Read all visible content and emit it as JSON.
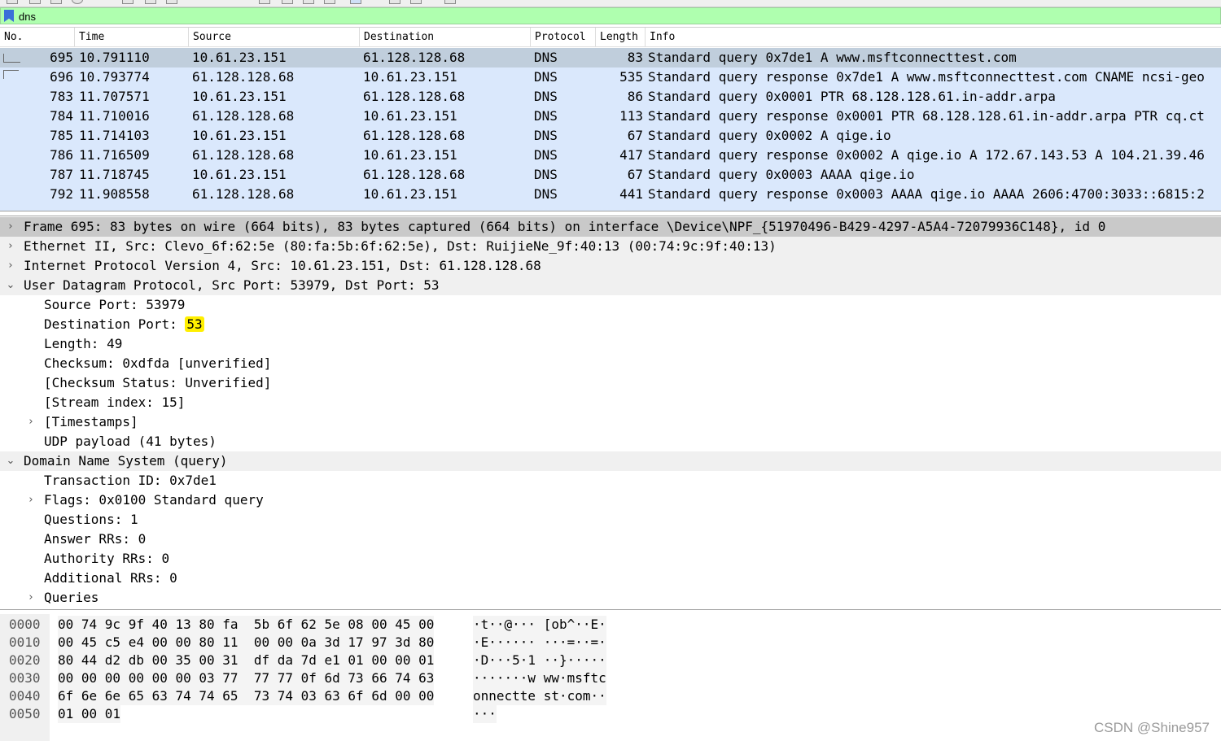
{
  "filter": {
    "value": "dns"
  },
  "packet_list": {
    "columns": [
      "No.",
      "Time",
      "Source",
      "Destination",
      "Protocol",
      "Length",
      "Info"
    ],
    "rows": [
      {
        "no": "695",
        "time": "10.791110",
        "src": "10.61.23.151",
        "dst": "61.128.128.68",
        "proto": "DNS",
        "len": "83",
        "info": "Standard query 0x7de1 A www.msftconnecttest.com"
      },
      {
        "no": "696",
        "time": "10.793774",
        "src": "61.128.128.68",
        "dst": "10.61.23.151",
        "proto": "DNS",
        "len": "535",
        "info": "Standard query response 0x7de1 A www.msftconnecttest.com CNAME ncsi-geo"
      },
      {
        "no": "783",
        "time": "11.707571",
        "src": "10.61.23.151",
        "dst": "61.128.128.68",
        "proto": "DNS",
        "len": "86",
        "info": "Standard query 0x0001 PTR 68.128.128.61.in-addr.arpa"
      },
      {
        "no": "784",
        "time": "11.710016",
        "src": "61.128.128.68",
        "dst": "10.61.23.151",
        "proto": "DNS",
        "len": "113",
        "info": "Standard query response 0x0001 PTR 68.128.128.61.in-addr.arpa PTR cq.ct"
      },
      {
        "no": "785",
        "time": "11.714103",
        "src": "10.61.23.151",
        "dst": "61.128.128.68",
        "proto": "DNS",
        "len": "67",
        "info": "Standard query 0x0002 A qige.io"
      },
      {
        "no": "786",
        "time": "11.716509",
        "src": "61.128.128.68",
        "dst": "10.61.23.151",
        "proto": "DNS",
        "len": "417",
        "info": "Standard query response 0x0002 A qige.io A 172.67.143.53 A 104.21.39.46"
      },
      {
        "no": "787",
        "time": "11.718745",
        "src": "10.61.23.151",
        "dst": "61.128.128.68",
        "proto": "DNS",
        "len": "67",
        "info": "Standard query 0x0003 AAAA qige.io"
      },
      {
        "no": "792",
        "time": "11.908558",
        "src": "61.128.128.68",
        "dst": "10.61.23.151",
        "proto": "DNS",
        "len": "441",
        "info": "Standard query response 0x0003 AAAA qige.io AAAA 2606:4700:3033::6815:2"
      }
    ]
  },
  "details": {
    "frame": "Frame 695: 83 bytes on wire (664 bits), 83 bytes captured (664 bits) on interface \\Device\\NPF_{51970496-B429-4297-A5A4-72079936C148}, id 0",
    "ethernet": "Ethernet II, Src: Clevo_6f:62:5e (80:fa:5b:6f:62:5e), Dst: RuijieNe_9f:40:13 (00:74:9c:9f:40:13)",
    "ip": "Internet Protocol Version 4, Src: 10.61.23.151, Dst: 61.128.128.68",
    "udp": "User Datagram Protocol, Src Port: 53979, Dst Port: 53",
    "udp_src_port": "Source Port: 53979",
    "udp_dst_port_label": "Destination Port: ",
    "udp_dst_port_value": "53",
    "udp_length": "Length: 49",
    "udp_checksum": "Checksum: 0xdfda [unverified]",
    "udp_checksum_status": "[Checksum Status: Unverified]",
    "udp_stream_index": "[Stream index: 15]",
    "udp_timestamps": "[Timestamps]",
    "udp_payload": "UDP payload (41 bytes)",
    "dns": "Domain Name System (query)",
    "dns_txid": "Transaction ID: 0x7de1",
    "dns_flags": "Flags: 0x0100 Standard query",
    "dns_questions": "Questions: 1",
    "dns_answer_rrs": "Answer RRs: 0",
    "dns_authority_rrs": "Authority RRs: 0",
    "dns_additional_rrs": "Additional RRs: 0",
    "dns_queries": "Queries"
  },
  "bytes": {
    "rows": [
      {
        "offset": "0000",
        "hex": "00 74 9c 9f 40 13 80 fa  5b 6f 62 5e 08 00 45 00",
        "ascii": "·t··@··· [ob^··E·"
      },
      {
        "offset": "0010",
        "hex": "00 45 c5 e4 00 00 80 11  00 00 0a 3d 17 97 3d 80",
        "ascii": "·E······ ···=··=·"
      },
      {
        "offset": "0020",
        "hex": "80 44 d2 db 00 35 00 31  df da 7d e1 01 00 00 01",
        "ascii": "·D···5·1 ··}·····"
      },
      {
        "offset": "0030",
        "hex": "00 00 00 00 00 00 03 77  77 77 0f 6d 73 66 74 63",
        "ascii": "·······w ww·msftc"
      },
      {
        "offset": "0040",
        "hex": "6f 6e 6e 65 63 74 74 65  73 74 03 63 6f 6d 00 00",
        "ascii": "onnectte st·com··"
      },
      {
        "offset": "0050",
        "hex": "01 00 01",
        "ascii": "···"
      }
    ]
  },
  "watermark": "CSDN @Shine957",
  "colors": {
    "filter_bg": "#afffaf",
    "row_bg": "#dae8fc",
    "selected_row_bg": "#c0cedc",
    "highlight": "#ffef00"
  }
}
